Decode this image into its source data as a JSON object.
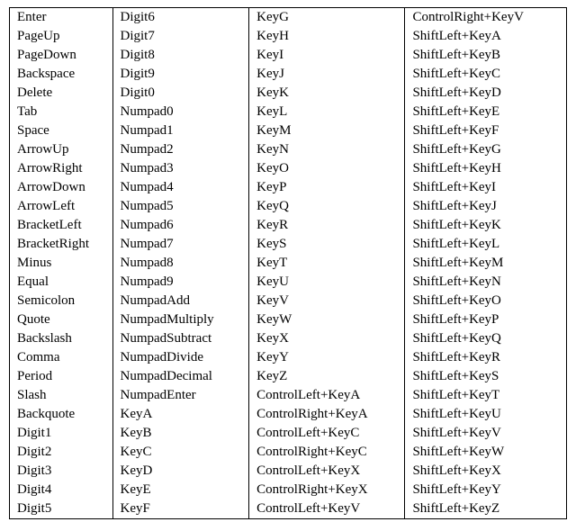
{
  "table": {
    "columns": [
      [
        "Enter",
        "PageUp",
        "PageDown",
        "Backspace",
        "Delete",
        "Tab",
        "Space",
        "ArrowUp",
        "ArrowRight",
        "ArrowDown",
        "ArrowLeft",
        "BracketLeft",
        "BracketRight",
        "Minus",
        "Equal",
        "Semicolon",
        "Quote",
        "Backslash",
        "Comma",
        "Period",
        "Slash",
        "Backquote",
        "Digit1",
        "Digit2",
        "Digit3",
        "Digit4",
        "Digit5"
      ],
      [
        "Digit6",
        "Digit7",
        "Digit8",
        "Digit9",
        "Digit0",
        "Numpad0",
        "Numpad1",
        "Numpad2",
        "Numpad3",
        "Numpad4",
        "Numpad5",
        "Numpad6",
        "Numpad7",
        "Numpad8",
        "Numpad9",
        "NumpadAdd",
        "NumpadMultiply",
        "NumpadSubtract",
        "NumpadDivide",
        "NumpadDecimal",
        "NumpadEnter",
        "KeyA",
        "KeyB",
        "KeyC",
        "KeyD",
        "KeyE",
        "KeyF"
      ],
      [
        "KeyG",
        "KeyH",
        "KeyI",
        "KeyJ",
        "KeyK",
        "KeyL",
        "KeyM",
        "KeyN",
        "KeyO",
        "KeyP",
        "KeyQ",
        "KeyR",
        "KeyS",
        "KeyT",
        "KeyU",
        "KeyV",
        "KeyW",
        "KeyX",
        "KeyY",
        "KeyZ",
        "ControlLeft+KeyA",
        "ControlRight+KeyA",
        "ControlLeft+KeyC",
        "ControlRight+KeyC",
        "ControlLeft+KeyX",
        "ControlRight+KeyX",
        "ControlLeft+KeyV"
      ],
      [
        "ControlRight+KeyV",
        "ShiftLeft+KeyA",
        "ShiftLeft+KeyB",
        "ShiftLeft+KeyC",
        "ShiftLeft+KeyD",
        "ShiftLeft+KeyE",
        "ShiftLeft+KeyF",
        "ShiftLeft+KeyG",
        "ShiftLeft+KeyH",
        "ShiftLeft+KeyI",
        "ShiftLeft+KeyJ",
        "ShiftLeft+KeyK",
        "ShiftLeft+KeyL",
        "ShiftLeft+KeyM",
        "ShiftLeft+KeyN",
        "ShiftLeft+KeyO",
        "ShiftLeft+KeyP",
        "ShiftLeft+KeyQ",
        "ShiftLeft+KeyR",
        "ShiftLeft+KeyS",
        "ShiftLeft+KeyT",
        "ShiftLeft+KeyU",
        "ShiftLeft+KeyV",
        "ShiftLeft+KeyW",
        "ShiftLeft+KeyX",
        "ShiftLeft+KeyY",
        "ShiftLeft+KeyZ"
      ]
    ]
  }
}
